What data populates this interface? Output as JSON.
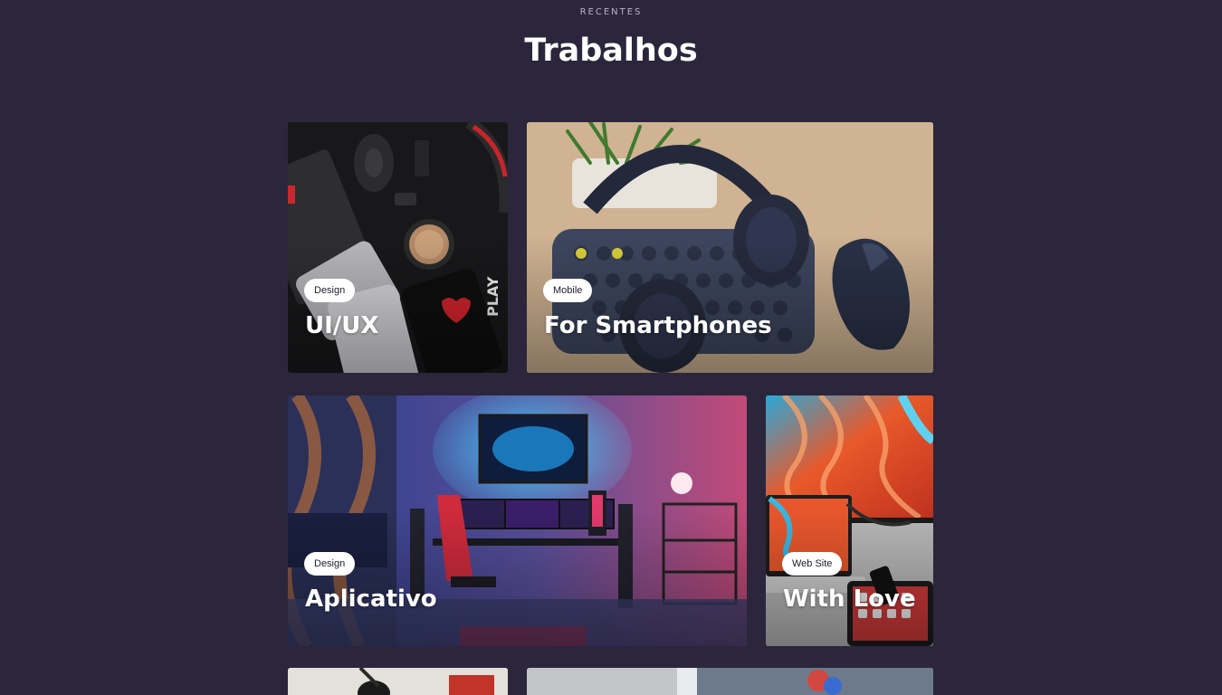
{
  "section": {
    "eyebrow": "RECENTES",
    "title": "Trabalhos"
  },
  "projects": [
    {
      "category": "Design",
      "title": "UI/UX",
      "image": "dark-desk-flatlay-image"
    },
    {
      "category": "Mobile",
      "title": "For Smartphones",
      "image": "keyboard-headphones-image"
    },
    {
      "category": "Design",
      "title": "Aplicativo",
      "image": "gaming-room-image"
    },
    {
      "category": "Web Site",
      "title": "With Love",
      "image": "laptop-wallpaper-image"
    }
  ],
  "colors": {
    "background": "#2b263b",
    "badge": "#ffffff",
    "badge_text": "#1f1a2d"
  }
}
